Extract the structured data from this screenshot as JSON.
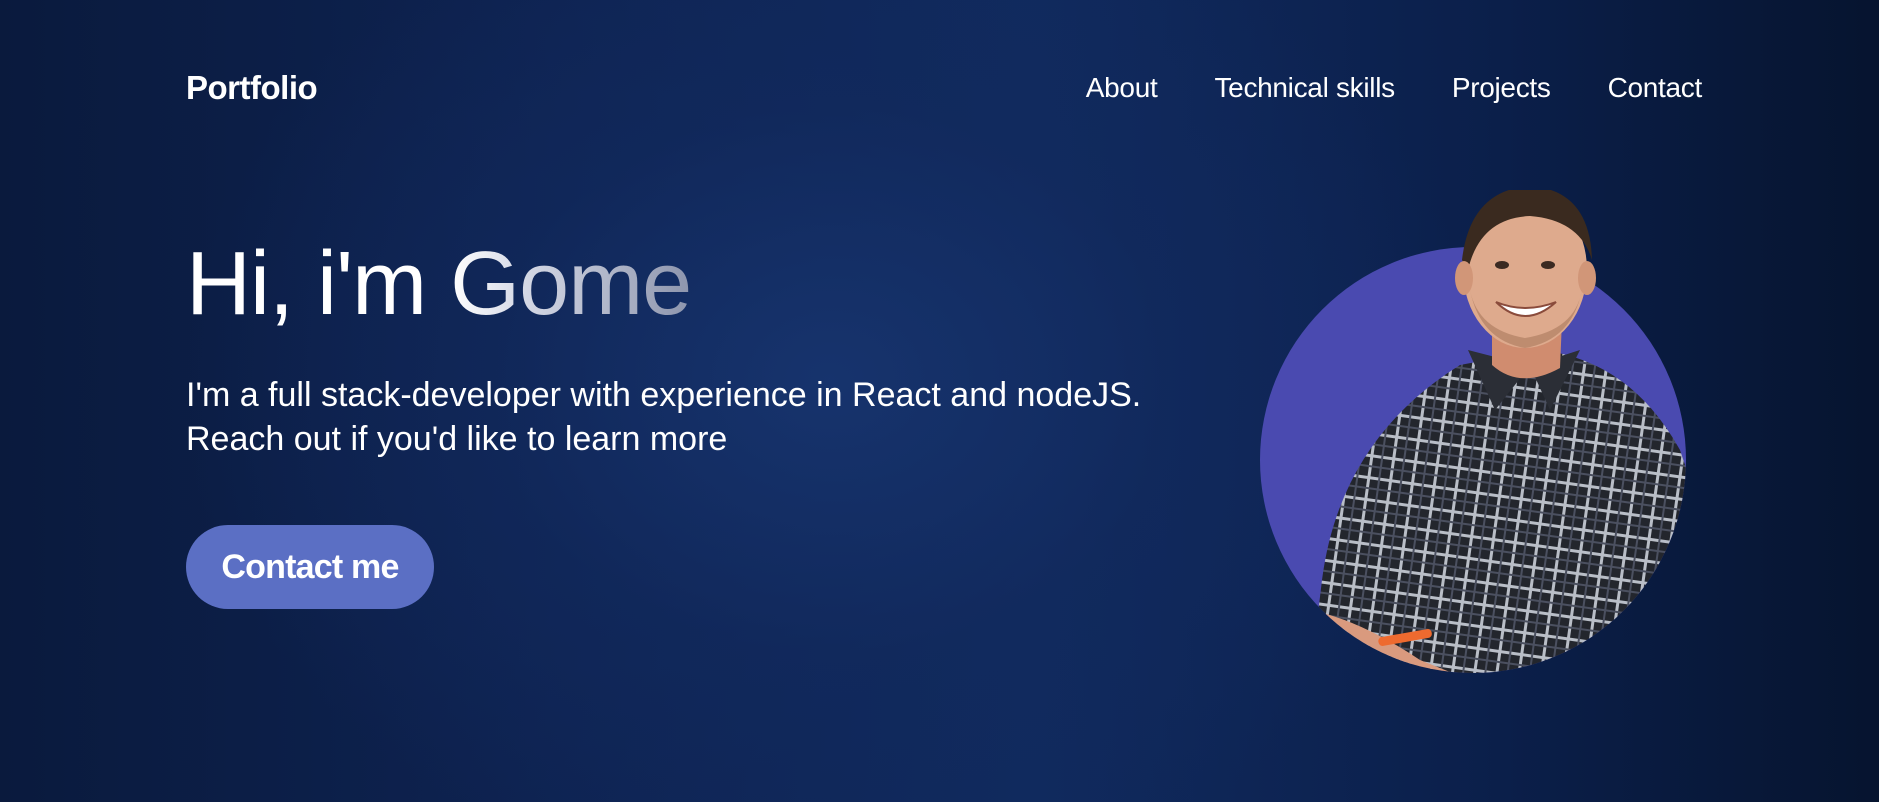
{
  "header": {
    "brand": "Portfolio",
    "nav": [
      {
        "label": "About"
      },
      {
        "label": "Technical skills"
      },
      {
        "label": "Projects"
      },
      {
        "label": "Contact"
      }
    ]
  },
  "hero": {
    "greeting": "Hi, i'm ",
    "name": "Gome",
    "description_line1": "I'm a full stack-developer with experience in React and nodeJS.",
    "description_line2": "Reach out if you'd like to learn more",
    "cta_label": "Contact me"
  },
  "colors": {
    "accent_button": "#5b6fc4",
    "portrait_circle": "#4a4ab0",
    "background_dark": "#0a1a3d",
    "background_glow": "#17346e"
  },
  "icons": {
    "portrait": "profile-photo"
  }
}
